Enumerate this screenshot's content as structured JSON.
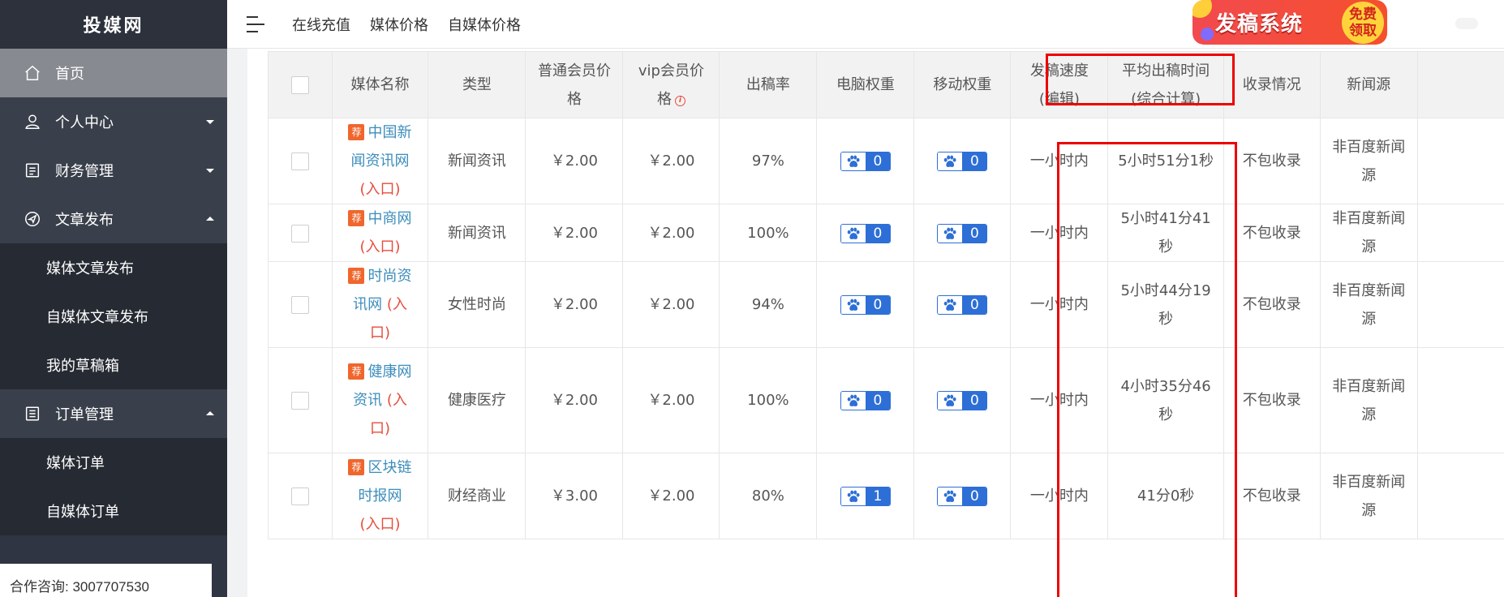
{
  "sidebar": {
    "logo": "投媒网",
    "items": [
      {
        "label": "首页",
        "icon": "home-icon",
        "active": true
      },
      {
        "label": "个人中心",
        "icon": "user-icon",
        "caret": "down"
      },
      {
        "label": "财务管理",
        "icon": "finance-icon",
        "caret": "down"
      },
      {
        "label": "文章发布",
        "icon": "send-icon",
        "caret": "up"
      },
      {
        "label": "媒体文章发布",
        "sub": true
      },
      {
        "label": "自媒体文章发布",
        "sub": true
      },
      {
        "label": "我的草稿箱",
        "sub": true
      },
      {
        "label": "订单管理",
        "icon": "order-icon",
        "caret": "up"
      },
      {
        "label": "媒体订单",
        "sub": true
      },
      {
        "label": "自媒体订单",
        "sub": true
      }
    ],
    "contact": "合作咨询: 3007707530"
  },
  "topbar": {
    "links": [
      "在线充值",
      "媒体价格",
      "自媒体价格"
    ],
    "banner_text": "发稿系统",
    "banner_badge_line1": "免费",
    "banner_badge_line2": "领取"
  },
  "table": {
    "headers": {
      "name": "媒体名称",
      "type": "类型",
      "normal_price_1": "普通会员价",
      "normal_price_2": "格",
      "vip_price_1": "vip会员价",
      "vip_price_2": "格",
      "rate": "出稿率",
      "pc_weight": "电脑权重",
      "mobile_weight": "移动权重",
      "speed_1": "发稿速度",
      "speed_2": "(编辑)",
      "avg_1": "平均出稿时间",
      "avg_2": "(综合计算)",
      "index": "收录情况",
      "news_source": "新闻源"
    },
    "rec_badge": "荐",
    "rows": [
      {
        "name_lines": [
          "中国新",
          "闻资讯网"
        ],
        "entry": "(入口)",
        "entry_inline": false,
        "type": "新闻资讯",
        "normal_price": "￥2.00",
        "vip_price": "￥2.00",
        "rate": "97%",
        "pc": "0",
        "mobile": "0",
        "speed": "一小时内",
        "avg_lines": [
          "5小时51分1秒"
        ],
        "index": "不包收录",
        "src_lines": [
          "非百度新闻",
          "源"
        ]
      },
      {
        "name_lines": [
          "中商网"
        ],
        "entry": "(入口)",
        "entry_inline": false,
        "type": "新闻资讯",
        "normal_price": "￥2.00",
        "vip_price": "￥2.00",
        "rate": "100%",
        "pc": "0",
        "mobile": "0",
        "speed": "一小时内",
        "avg_lines": [
          "5小时41分41",
          "秒"
        ],
        "index": "不包收录",
        "src_lines": [
          "非百度新闻",
          "源"
        ]
      },
      {
        "name_lines": [
          "时尚资",
          "讯网"
        ],
        "entry": "(入",
        "entry_tail": "口)",
        "entry_inline": true,
        "type": "女性时尚",
        "normal_price": "￥2.00",
        "vip_price": "￥2.00",
        "rate": "94%",
        "pc": "0",
        "mobile": "0",
        "speed": "一小时内",
        "avg_lines": [
          "5小时44分19",
          "秒"
        ],
        "index": "不包收录",
        "src_lines": [
          "非百度新闻",
          "源"
        ]
      },
      {
        "name_lines": [
          "健康网",
          "资讯"
        ],
        "entry": "(入",
        "entry_tail": "口)",
        "entry_inline": true,
        "type": "健康医疗",
        "normal_price": "￥2.00",
        "vip_price": "￥2.00",
        "rate": "100%",
        "pc": "0",
        "mobile": "0",
        "speed": "一小时内",
        "avg_lines": [
          "4小时35分46",
          "秒"
        ],
        "index": "不包收录",
        "src_lines": [
          "非百度新闻",
          "源"
        ]
      },
      {
        "name_lines": [
          "区块链",
          "时报网"
        ],
        "entry": "(入口)",
        "entry_inline": false,
        "type": "财经商业",
        "normal_price": "￥3.00",
        "vip_price": "￥2.00",
        "rate": "80%",
        "pc": "1",
        "mobile": "0",
        "speed": "一小时内",
        "avg_lines": [
          "41分0秒"
        ],
        "index": "不包收录",
        "src_lines": [
          "非百度新闻",
          "源"
        ]
      }
    ]
  },
  "colors": {
    "sidebar_bg": "#2f3542",
    "active_bg": "#878a90",
    "link_blue": "#3c8dbc",
    "entry_red": "#e74c3c",
    "weight_blue": "#2d6fd6",
    "highlight_red": "#ee0000"
  }
}
